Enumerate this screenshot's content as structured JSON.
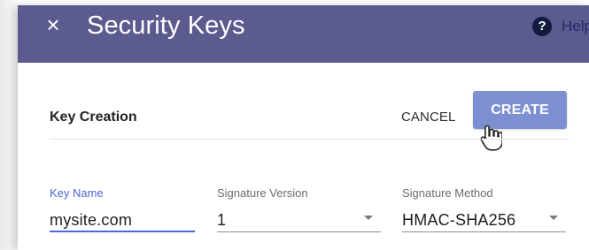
{
  "header": {
    "title": "Security Keys",
    "help_label": "Help"
  },
  "section": {
    "title": "Key Creation",
    "cancel_label": "CANCEL",
    "create_label": "CREATE"
  },
  "form": {
    "key_name": {
      "label": "Key Name",
      "value": "mysite.com"
    },
    "signature_version": {
      "label": "Signature Version",
      "value": "1"
    },
    "signature_method": {
      "label": "Signature Method",
      "value": "HMAC-SHA256"
    }
  },
  "icons": {
    "close": "close-icon",
    "help": "help-icon",
    "cursor": "hand-pointer-icon",
    "dropdown": "dropdown-arrow-icon"
  },
  "colors": {
    "header_bg": "#5b5b8f",
    "primary": "#7c8fd1",
    "focus": "#4b67d6",
    "help_text": "#1f2a66"
  }
}
